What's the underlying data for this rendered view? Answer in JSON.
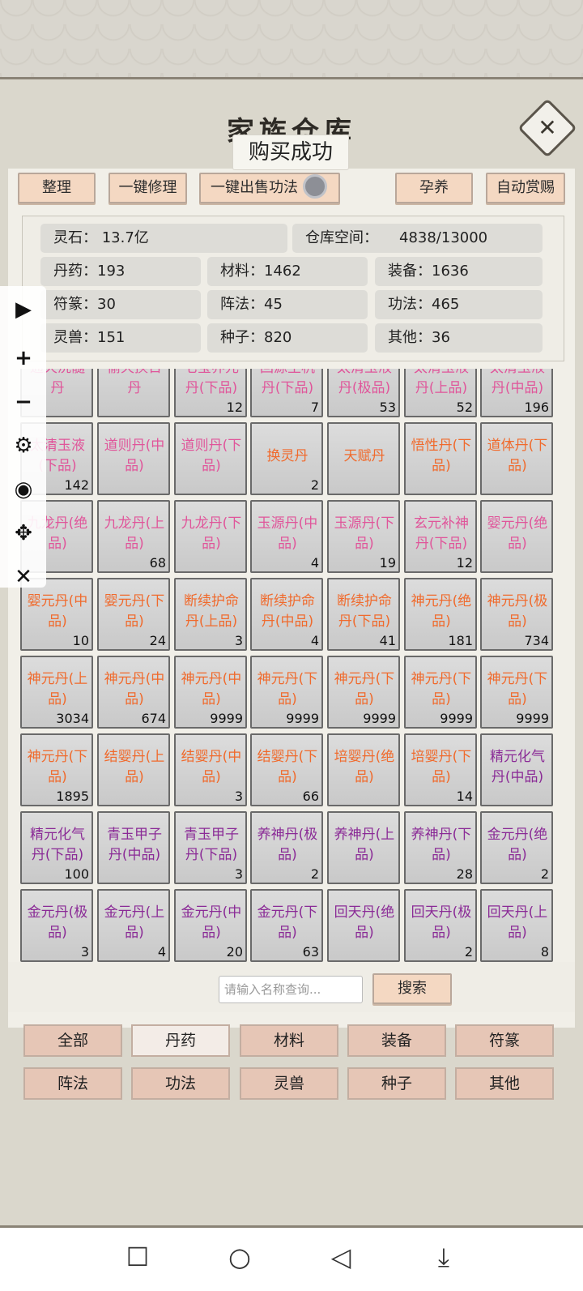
{
  "title": "家族仓库",
  "toast": "购买成功",
  "close_icon": "✕",
  "toolbar": {
    "tidy": "整理",
    "repair_all": "一键修理",
    "sell_skills": "一键出售功法",
    "nurture": "孕养",
    "auto_reward": "自动赏赐"
  },
  "stats": {
    "spirit_stone": "灵石：  13.7亿",
    "storage_label": "仓库空间：",
    "storage_value": "4838/13000",
    "pills": "丹药：193",
    "materials": "材料：1462",
    "equipment": "装备：1636",
    "talismans": "符篆：30",
    "formations": "阵法：45",
    "skills": "功法：465",
    "beasts": "灵兽：151",
    "seeds": "种子：820",
    "others": "其他：36"
  },
  "colors": {
    "orange": "#f06a2c",
    "pink": "#e0559a",
    "purple": "#8a2a96"
  },
  "items": [
    {
      "name": "通天洗髓丹",
      "count": "",
      "color": "pink"
    },
    {
      "name": "偷天换日丹",
      "count": "",
      "color": "pink"
    },
    {
      "name": "七宝养元丹(下品)",
      "count": "12",
      "color": "pink"
    },
    {
      "name": "回源生机丹(下品)",
      "count": "7",
      "color": "pink"
    },
    {
      "name": "太清玉液丹(极品)",
      "count": "53",
      "color": "pink"
    },
    {
      "name": "太清玉液丹(上品)",
      "count": "52",
      "color": "pink"
    },
    {
      "name": "太清玉液丹(中品)",
      "count": "196",
      "color": "pink"
    },
    {
      "name": "太清玉液(下品)",
      "count": "142",
      "color": "pink"
    },
    {
      "name": "道则丹(中品)",
      "count": "",
      "color": "pink"
    },
    {
      "name": "道则丹(下品)",
      "count": "",
      "color": "pink"
    },
    {
      "name": "换灵丹",
      "count": "2",
      "color": "orange"
    },
    {
      "name": "天赋丹",
      "count": "",
      "color": "orange"
    },
    {
      "name": "悟性丹(下品)",
      "count": "",
      "color": "orange"
    },
    {
      "name": "道体丹(下品)",
      "count": "",
      "color": "orange"
    },
    {
      "name": "九龙丹(绝品)",
      "count": "",
      "color": "pink"
    },
    {
      "name": "九龙丹(上品)",
      "count": "68",
      "color": "pink"
    },
    {
      "name": "九龙丹(下品)",
      "count": "",
      "color": "pink"
    },
    {
      "name": "玉源丹(中品)",
      "count": "4",
      "color": "pink"
    },
    {
      "name": "玉源丹(下品)",
      "count": "19",
      "color": "pink"
    },
    {
      "name": "玄元补神丹(下品)",
      "count": "12",
      "color": "pink"
    },
    {
      "name": "婴元丹(绝品)",
      "count": "",
      "color": "pink"
    },
    {
      "name": "婴元丹(中品)",
      "count": "10",
      "color": "orange"
    },
    {
      "name": "婴元丹(下品)",
      "count": "24",
      "color": "orange"
    },
    {
      "name": "断续护命丹(上品)",
      "count": "3",
      "color": "orange"
    },
    {
      "name": "断续护命丹(中品)",
      "count": "4",
      "color": "orange"
    },
    {
      "name": "断续护命丹(下品)",
      "count": "41",
      "color": "orange"
    },
    {
      "name": "神元丹(绝品)",
      "count": "181",
      "color": "orange"
    },
    {
      "name": "神元丹(极品)",
      "count": "734",
      "color": "orange"
    },
    {
      "name": "神元丹(上品)",
      "count": "3034",
      "color": "orange"
    },
    {
      "name": "神元丹(中品)",
      "count": "674",
      "color": "orange"
    },
    {
      "name": "神元丹(中品)",
      "count": "9999",
      "color": "orange"
    },
    {
      "name": "神元丹(下品)",
      "count": "9999",
      "color": "orange"
    },
    {
      "name": "神元丹(下品)",
      "count": "9999",
      "color": "orange"
    },
    {
      "name": "神元丹(下品)",
      "count": "9999",
      "color": "orange"
    },
    {
      "name": "神元丹(下品)",
      "count": "9999",
      "color": "orange"
    },
    {
      "name": "神元丹(下品)",
      "count": "1895",
      "color": "orange"
    },
    {
      "name": "结婴丹(上品)",
      "count": "",
      "color": "orange"
    },
    {
      "name": "结婴丹(中品)",
      "count": "3",
      "color": "orange"
    },
    {
      "name": "结婴丹(下品)",
      "count": "66",
      "color": "orange"
    },
    {
      "name": "培婴丹(绝品)",
      "count": "",
      "color": "orange"
    },
    {
      "name": "培婴丹(下品)",
      "count": "14",
      "color": "orange"
    },
    {
      "name": "精元化气丹(中品)",
      "count": "",
      "color": "purple"
    },
    {
      "name": "精元化气丹(下品)",
      "count": "100",
      "color": "purple"
    },
    {
      "name": "青玉甲子丹(中品)",
      "count": "",
      "color": "purple"
    },
    {
      "name": "青玉甲子丹(下品)",
      "count": "3",
      "color": "purple"
    },
    {
      "name": "养神丹(极品)",
      "count": "2",
      "color": "purple"
    },
    {
      "name": "养神丹(上品)",
      "count": "",
      "color": "purple"
    },
    {
      "name": "养神丹(下品)",
      "count": "28",
      "color": "purple"
    },
    {
      "name": "金元丹(绝品)",
      "count": "2",
      "color": "purple"
    },
    {
      "name": "金元丹(极品)",
      "count": "3",
      "color": "purple"
    },
    {
      "name": "金元丹(上品)",
      "count": "4",
      "color": "purple"
    },
    {
      "name": "金元丹(中品)",
      "count": "20",
      "color": "purple"
    },
    {
      "name": "金元丹(下品)",
      "count": "63",
      "color": "purple"
    },
    {
      "name": "回天丹(绝品)",
      "count": "",
      "color": "purple"
    },
    {
      "name": "回天丹(极品)",
      "count": "2",
      "color": "purple"
    },
    {
      "name": "回天丹(上品)",
      "count": "8",
      "color": "purple"
    }
  ],
  "search": {
    "placeholder": "请输入名称查询...",
    "button": "搜索"
  },
  "categories": [
    "全部",
    "丹药",
    "材料",
    "装备",
    "符篆",
    "阵法",
    "功法",
    "灵兽",
    "种子",
    "其他"
  ],
  "active_category": "丹药",
  "sidebar_icons": [
    "play-icon",
    "plus-icon",
    "minus-icon",
    "gear-icon",
    "eye-icon",
    "move-icon",
    "close-icon"
  ],
  "nav_icons": [
    "square-icon",
    "circle-icon",
    "back-triangle-icon",
    "download-icon"
  ]
}
